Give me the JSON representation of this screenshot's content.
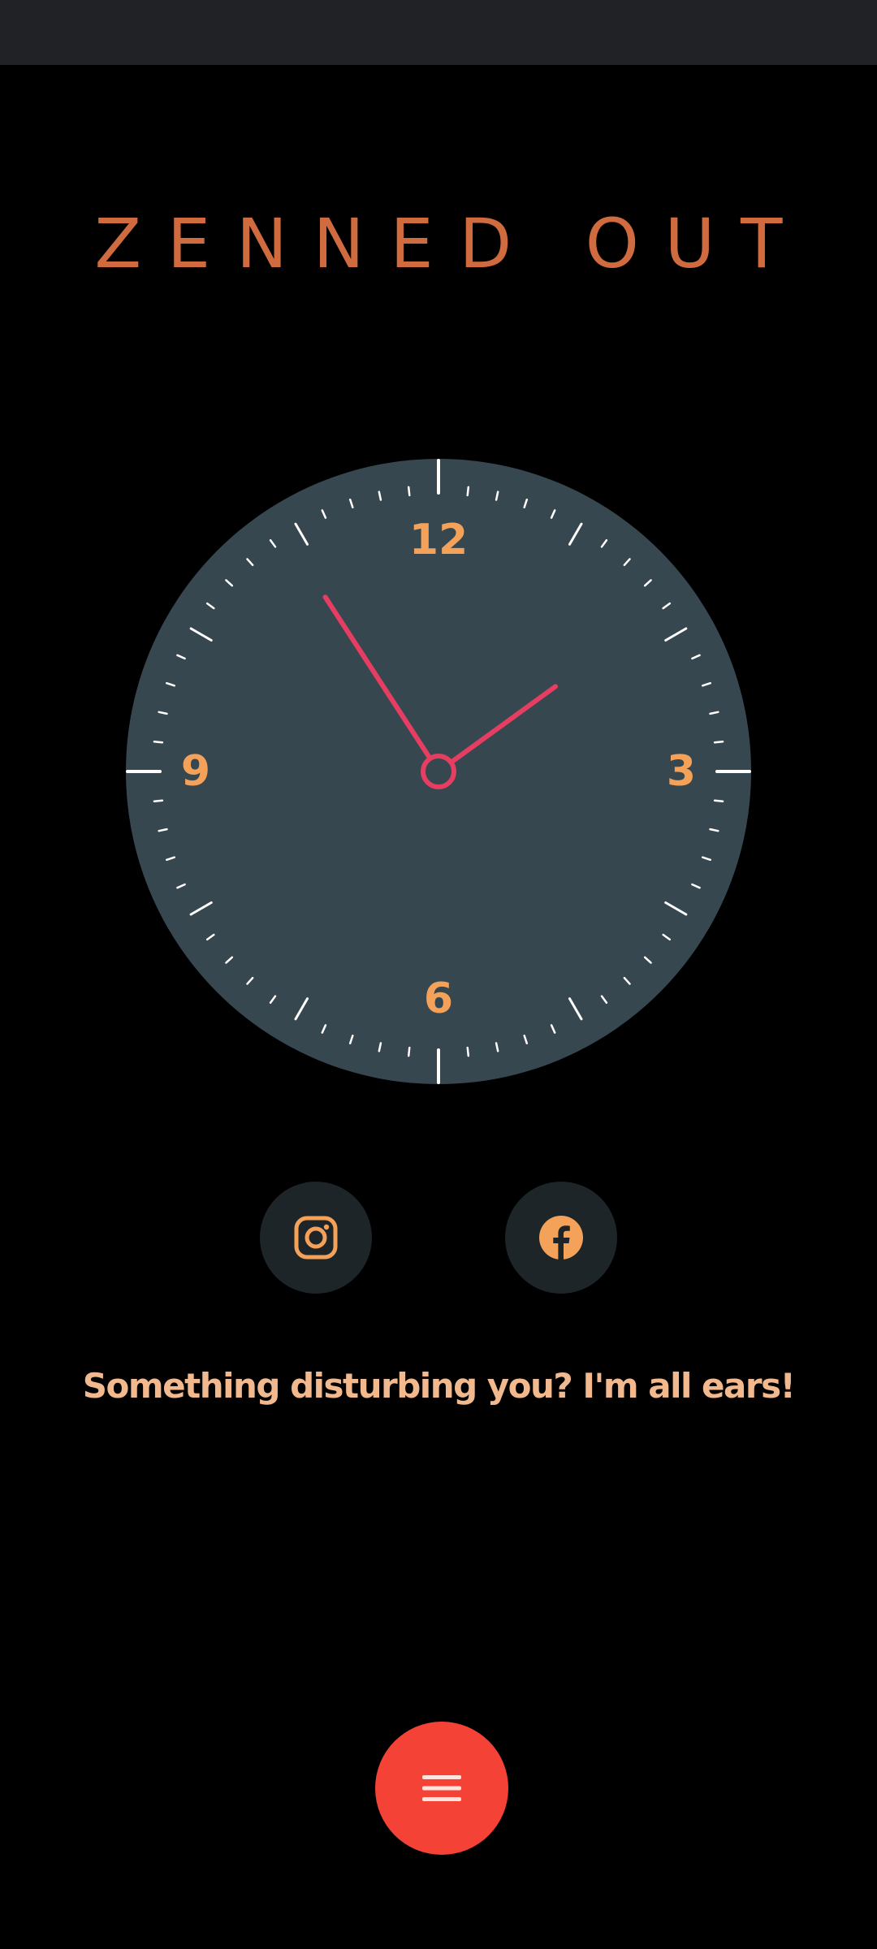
{
  "app": {
    "title": "ZENNED OUT"
  },
  "clock": {
    "numerals": {
      "twelve": "12",
      "three": "3",
      "six": "6",
      "nine": "9"
    },
    "hour_value": 1.8,
    "minute_value": 54.5
  },
  "social": {
    "instagram_icon": "instagram-icon",
    "facebook_icon": "facebook-icon"
  },
  "prompt": {
    "text": "Something disturbing you? I'm all ears!"
  },
  "fab": {
    "icon": "menu-icon"
  },
  "colors": {
    "background": "#000000",
    "status_bar": "#202225",
    "title": "#cf6b3f",
    "clock_face": "#37474f",
    "accent_orange": "#f4a259",
    "hands": "#e63e62",
    "social_button_bg": "#1d2529",
    "prompt_text": "#f2b98f",
    "fab": "#f44336"
  }
}
